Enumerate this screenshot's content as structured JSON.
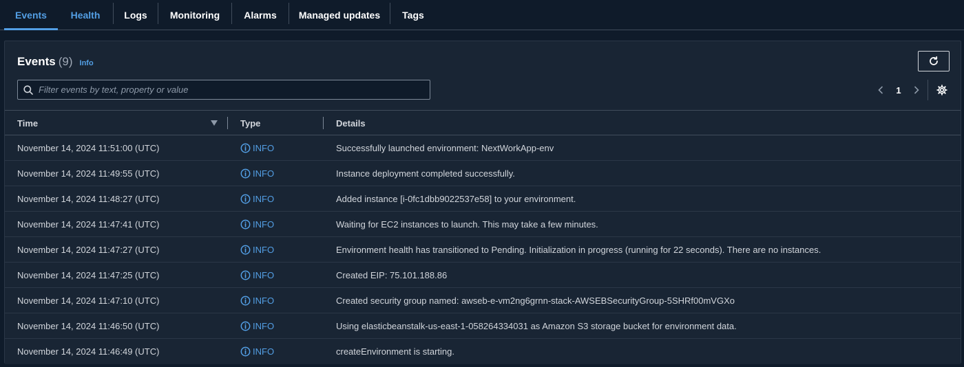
{
  "tabs": [
    {
      "label": "Events",
      "active": true
    },
    {
      "label": "Health"
    },
    {
      "label": "Logs"
    },
    {
      "label": "Monitoring"
    },
    {
      "label": "Alarms"
    },
    {
      "label": "Managed updates"
    },
    {
      "label": "Tags"
    }
  ],
  "panel": {
    "title": "Events",
    "count": "(9)",
    "info": "Info"
  },
  "search": {
    "placeholder": "Filter events by text, property or value",
    "icon": "search-icon"
  },
  "pagination": {
    "current_page": "1"
  },
  "table": {
    "columns": [
      "Time",
      "Type",
      "Details"
    ],
    "rows": [
      {
        "time": "November 14, 2024 11:51:00 (UTC)",
        "type": "INFO",
        "details": "Successfully launched environment: NextWorkApp-env"
      },
      {
        "time": "November 14, 2024 11:49:55 (UTC)",
        "type": "INFO",
        "details": "Instance deployment completed successfully."
      },
      {
        "time": "November 14, 2024 11:48:27 (UTC)",
        "type": "INFO",
        "details": "Added instance [i-0fc1dbb9022537e58] to your environment."
      },
      {
        "time": "November 14, 2024 11:47:41 (UTC)",
        "type": "INFO",
        "details": "Waiting for EC2 instances to launch. This may take a few minutes."
      },
      {
        "time": "November 14, 2024 11:47:27 (UTC)",
        "type": "INFO",
        "details": "Environment health has transitioned to Pending. Initialization in progress (running for 22 seconds). There are no instances."
      },
      {
        "time": "November 14, 2024 11:47:25 (UTC)",
        "type": "INFO",
        "details": "Created EIP: 75.101.188.86"
      },
      {
        "time": "November 14, 2024 11:47:10 (UTC)",
        "type": "INFO",
        "details": "Created security group named: awseb-e-vm2ng6grnn-stack-AWSEBSecurityGroup-5SHRf00mVGXo"
      },
      {
        "time": "November 14, 2024 11:46:50 (UTC)",
        "type": "INFO",
        "details": "Using elasticbeanstalk-us-east-1-058264334031 as Amazon S3 storage bucket for environment data."
      },
      {
        "time": "November 14, 2024 11:46:49 (UTC)",
        "type": "INFO",
        "details": "createEnvironment is starting."
      }
    ]
  },
  "colors": {
    "background": "#0f1b2a",
    "panel": "#192534",
    "accent": "#539fe5",
    "text": "#d1d5db"
  }
}
